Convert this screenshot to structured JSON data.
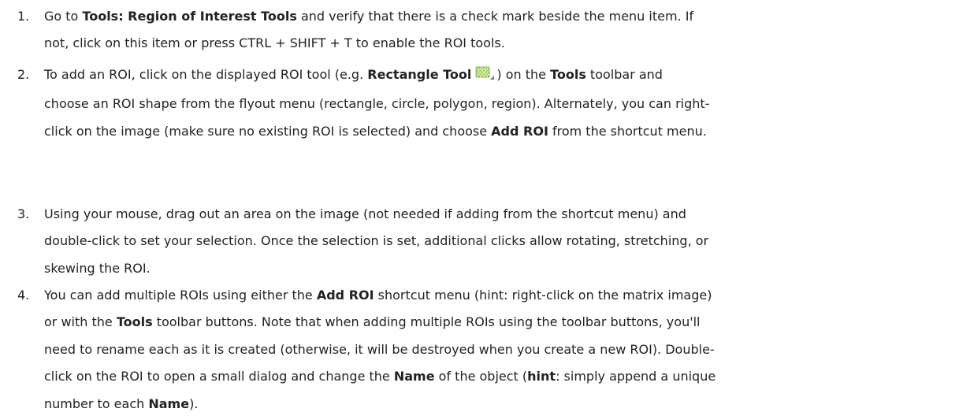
{
  "steps": [
    {
      "number": "1.",
      "lines": [
        [
          {
            "t": "Go to ",
            "b": false
          },
          {
            "t": "Tools: Region of Interest Tools",
            "b": true
          },
          {
            "t": " and verify that there is a check mark beside the menu item. If",
            "b": false
          }
        ],
        [
          {
            "t": "not, click on this item or press CTRL + SHIFT + T to enable the ROI tools.",
            "b": false
          }
        ]
      ]
    },
    {
      "number": "2.",
      "lines": [
        [
          {
            "t": "To add an ROI, click on the displayed ROI tool (e.g. ",
            "b": false
          },
          {
            "t": "Rectangle Tool",
            "b": true
          },
          {
            "icon": "rectangle-tool-icon"
          },
          {
            "t": ") on the ",
            "b": false
          },
          {
            "t": "Tools",
            "b": true
          },
          {
            "t": " toolbar and",
            "b": false
          }
        ],
        [
          {
            "t": "choose an ROI shape from the flyout menu (rectangle, circle, polygon, region). Alternately, you can right-",
            "b": false
          }
        ],
        [
          {
            "t": "click on the image (make sure no existing ROI is selected) and choose ",
            "b": false
          },
          {
            "t": "Add ROI",
            "b": true
          },
          {
            "t": " from the shortcut menu.",
            "b": false
          }
        ]
      ]
    },
    {
      "number": "3.",
      "lines": [
        [
          {
            "t": "Using your mouse, drag out an area on the image (not needed if adding from the shortcut menu) and",
            "b": false
          }
        ],
        [
          {
            "t": "double-click to set your selection. Once the selection is set, additional clicks allow rotating, stretching, or",
            "b": false
          }
        ],
        [
          {
            "t": "skewing the ROI.",
            "b": false
          }
        ]
      ]
    },
    {
      "number": "4.",
      "lines": [
        [
          {
            "t": "You can add multiple ROIs using either the ",
            "b": false
          },
          {
            "t": "Add ROI",
            "b": true
          },
          {
            "t": " shortcut menu (hint: right-click on the matrix image)",
            "b": false
          }
        ],
        [
          {
            "t": "or with the ",
            "b": false
          },
          {
            "t": "Tools",
            "b": true
          },
          {
            "t": " toolbar buttons. Note that when adding multiple ROIs using the toolbar buttons, you'll",
            "b": false
          }
        ],
        [
          {
            "t": "need to rename each as it is created (otherwise, it will be destroyed when you create a new ROI). Double-",
            "b": false
          }
        ],
        [
          {
            "t": "click on the ROI to open a small dialog and change the ",
            "b": false
          },
          {
            "t": "Name",
            "b": true
          },
          {
            "t": " of the object (",
            "b": false
          },
          {
            "t": "hint",
            "b": true
          },
          {
            "t": ": simply append a unique",
            "b": false
          }
        ],
        [
          {
            "t": "number to each ",
            "b": false
          },
          {
            "t": "Name",
            "b": true
          },
          {
            "t": ").",
            "b": false
          }
        ]
      ]
    }
  ]
}
